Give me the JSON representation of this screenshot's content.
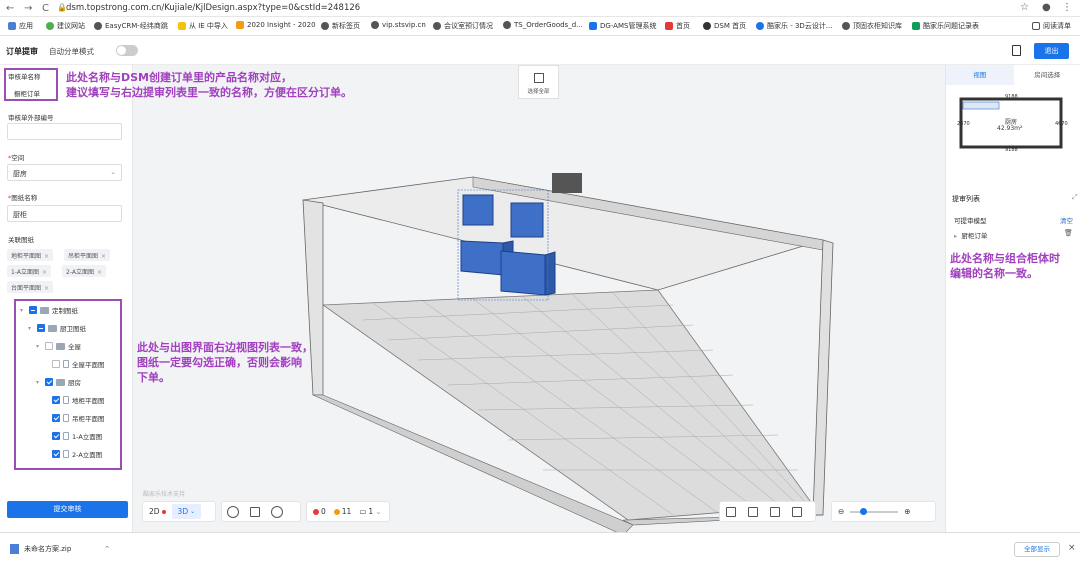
{
  "browser": {
    "url": "dsm.topstrong.com.cn/Kujiale/KjlDesign.aspx?type=0&cstId=248126",
    "reading_list": "阅读清单",
    "bookmarks": [
      "应用",
      "建议网站",
      "EasyCRM-经纬商跳",
      "从 IE 中导入",
      "2020 Insight - 2020",
      "新标签页",
      "vip.stsvip.cn",
      "会议室预订情况",
      "TS_OrderGoods_d...",
      "DG-AMS管理系统",
      "首页",
      "DSM 首页",
      "酷家乐 - 3D云设计...",
      "顶固衣柜知识库",
      "酷家乐问题记录表"
    ]
  },
  "header": {
    "title": "订单提审",
    "auto_split_label": "自动分单模式",
    "exit_label": "退出"
  },
  "left": {
    "review_name_label": "审核单名称",
    "review_name_value": "橱柜订单",
    "ext_id_label": "审核单外部编号",
    "space_label": "空间",
    "space_value": "厨房",
    "drawing_name_label": "图纸名称",
    "drawing_name_value": "厨柜",
    "related_label": "关联图纸",
    "tags": [
      "地柜平面图",
      "吊柜平面图",
      "1-A立面图",
      "2-A立面图",
      "台面平面图"
    ],
    "tree": [
      {
        "label": "定制图纸"
      },
      {
        "label": "厨卫图纸"
      },
      {
        "label": "全屋"
      },
      {
        "label": "全屋平面图"
      },
      {
        "label": "厨房"
      },
      {
        "label": "地柜平面图"
      },
      {
        "label": "吊柜平面图"
      },
      {
        "label": "1-A立面图"
      },
      {
        "label": "2-A立面图"
      }
    ],
    "submit_label": "提交审核"
  },
  "canvas": {
    "select_all_label": "选择全部",
    "watermark": "酷家乐技术支持",
    "view_2d": "2D",
    "view_3d": "3D",
    "err_count": "0",
    "warn_count": "11",
    "page_count": "1",
    "colors": {
      "cabinet": "#3f70c8",
      "wall": "#e8e8e8",
      "floor": "#d8d8d8"
    }
  },
  "right": {
    "tab_view": "视图",
    "tab_region": "房间选择",
    "room_name": "厨房",
    "room_area": "42.93m²",
    "dim_top": "9188",
    "dim_bottom": "9188",
    "dim_left": "2870",
    "dim_right": "4670",
    "list_title": "提审列表",
    "list_sub": "可提审模型",
    "list_clear": "清空",
    "list_item": "厨柜订单"
  },
  "annotations": {
    "a1_line1": "此处名称与DSM创建订单里的产品名称对应，",
    "a1_line2": "建议填写与右边提审列表里一致的名称，方便在区分订单。",
    "a2_line1": "此处与出图界面右边视图列表一致，",
    "a2_line2": "图纸一定要勾选正确，否则会影响",
    "a2_line3": "下单。",
    "a3_line1": "此处名称与组合柜体时",
    "a3_line2": "编辑的名称一致。"
  },
  "download": {
    "file_name": "未命名方案.zip",
    "show_all": "全部显示"
  }
}
